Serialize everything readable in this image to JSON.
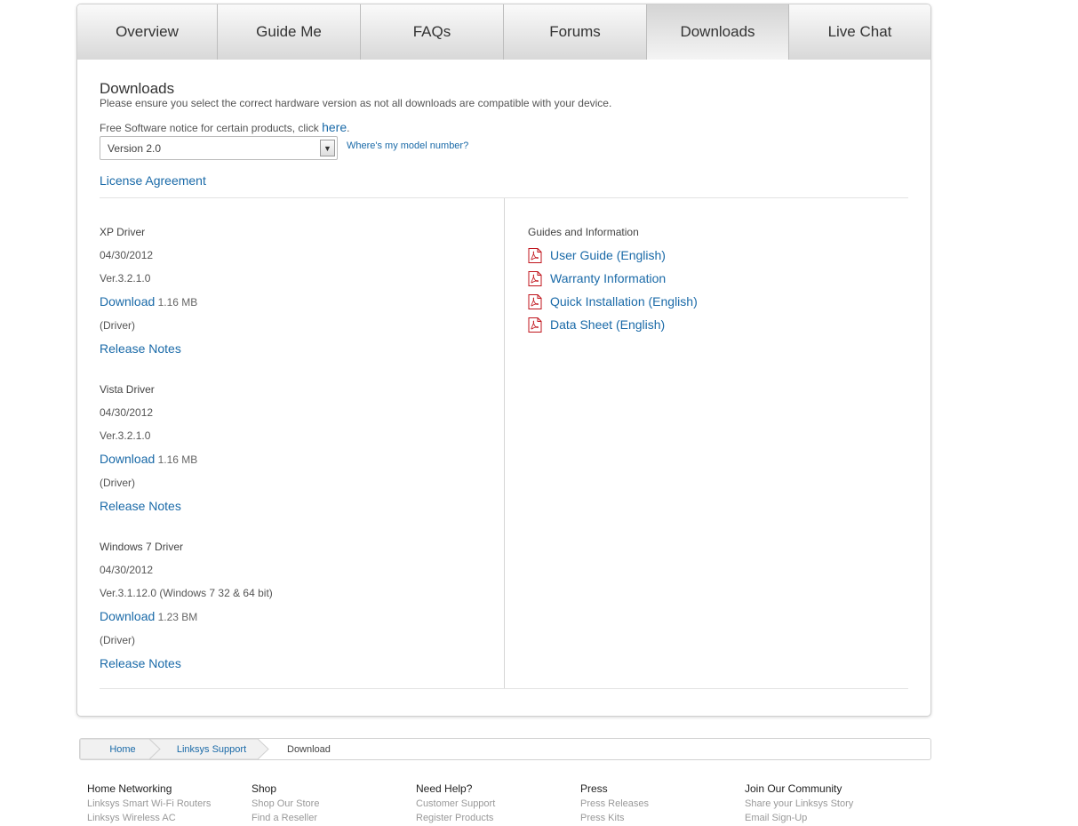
{
  "tabs": [
    "Overview",
    "Guide Me",
    "FAQs",
    "Forums",
    "Downloads",
    "Live Chat"
  ],
  "active_tab": "Downloads",
  "section_title": "Downloads",
  "subtitle": "Please ensure you select the correct hardware version as not all downloads are compatible with your device.",
  "notice": {
    "text": "Free Software notice for certain products, click ",
    "link": "here",
    "suffix": "."
  },
  "version_select": {
    "value": "Version 2.0"
  },
  "model_link": "Where's my model number?",
  "license_link": "License Agreement",
  "drivers": [
    {
      "name": "XP Driver",
      "date": "04/30/2012",
      "version": "Ver.3.2.1.0",
      "download_label": "Download",
      "size": "1.16 MB",
      "type": "(Driver)",
      "notes_label": "Release Notes"
    },
    {
      "name": "Vista Driver",
      "date": "04/30/2012",
      "version": "Ver.3.2.1.0",
      "download_label": "Download",
      "size": "1.16 MB",
      "type": "(Driver)",
      "notes_label": "Release Notes"
    },
    {
      "name": "Windows 7 Driver",
      "date": "04/30/2012",
      "version": "Ver.3.1.12.0 (Windows 7 32 & 64 bit)",
      "download_label": "Download",
      "size": "1.23 BM",
      "type": "(Driver)",
      "notes_label": "Release Notes"
    }
  ],
  "guides": {
    "heading": "Guides and Information",
    "items": [
      "User Guide (English)",
      "Warranty Information",
      "Quick Installation (English)",
      "Data Sheet (English)"
    ],
    "icon": "pdf-icon"
  },
  "breadcrumb": [
    "Home",
    "Linksys Support",
    "Download"
  ],
  "footer": [
    {
      "heading": "Home Networking",
      "links": [
        "Linksys Smart Wi-Fi Routers",
        "Linksys Wireless AC"
      ]
    },
    {
      "heading": "Shop",
      "links": [
        "Shop Our Store",
        "Find a Reseller"
      ]
    },
    {
      "heading": "Need Help?",
      "links": [
        "Customer Support",
        "Register Products"
      ]
    },
    {
      "heading": "Press",
      "links": [
        "Press Releases",
        "Press Kits"
      ]
    },
    {
      "heading": "Join Our Community",
      "links": [
        "Share your Linksys Story",
        "Email Sign-Up"
      ]
    }
  ],
  "colors": {
    "link": "#1a6aa8",
    "text": "#333333",
    "muted": "#999999",
    "pdf_red": "#c0141c"
  }
}
